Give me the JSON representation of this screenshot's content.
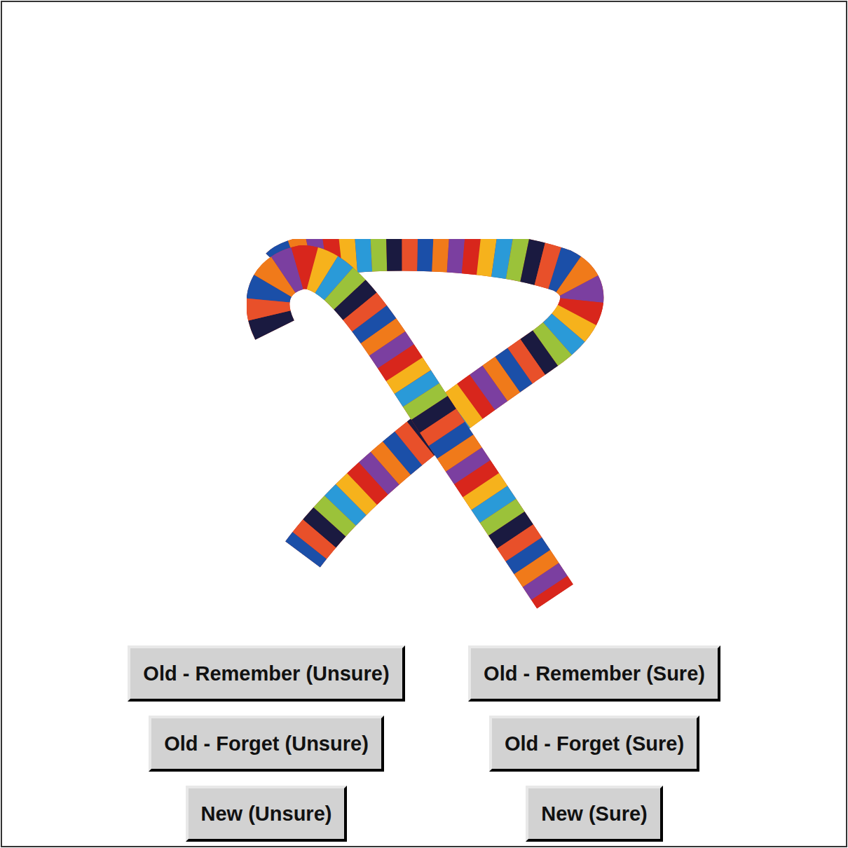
{
  "buttons": [
    "Old - Remember (Unsure)",
    "Old - Remember (Sure)",
    "Old - Forget (Unsure)",
    "Old - Forget (Sure)",
    "New (Unsure)",
    "New (Sure)"
  ]
}
